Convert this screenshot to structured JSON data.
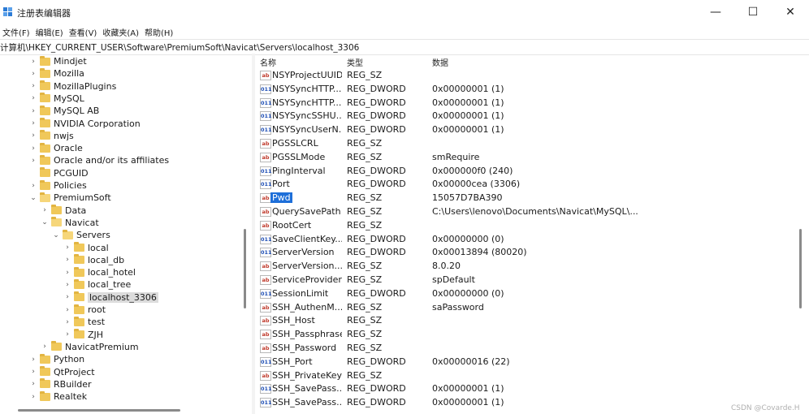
{
  "window": {
    "title": "注册表编辑器",
    "minimize": "—",
    "maximize": "☐",
    "close": "✕"
  },
  "menu": [
    "文件(F)",
    "编辑(E)",
    "查看(V)",
    "收藏夹(A)",
    "帮助(H)"
  ],
  "address": "计算机\\HKEY_CURRENT_USER\\Software\\PremiumSoft\\Navicat\\Servers\\localhost_3306",
  "tree": [
    {
      "label": "Mindjet",
      "depth": 0,
      "chev": "›",
      "open": false,
      "selected": false
    },
    {
      "label": "Mozilla",
      "depth": 0,
      "chev": "›",
      "open": false,
      "selected": false
    },
    {
      "label": "MozillaPlugins",
      "depth": 0,
      "chev": "›",
      "open": false,
      "selected": false
    },
    {
      "label": "MySQL",
      "depth": 0,
      "chev": "›",
      "open": false,
      "selected": false
    },
    {
      "label": "MySQL AB",
      "depth": 0,
      "chev": "›",
      "open": false,
      "selected": false
    },
    {
      "label": "NVIDIA Corporation",
      "depth": 0,
      "chev": "›",
      "open": false,
      "selected": false
    },
    {
      "label": "nwjs",
      "depth": 0,
      "chev": "›",
      "open": false,
      "selected": false
    },
    {
      "label": "Oracle",
      "depth": 0,
      "chev": "›",
      "open": false,
      "selected": false
    },
    {
      "label": "Oracle and/or its affiliates",
      "depth": 0,
      "chev": "›",
      "open": false,
      "selected": false
    },
    {
      "label": "PCGUID",
      "depth": 0,
      "chev": "",
      "open": false,
      "selected": false
    },
    {
      "label": "Policies",
      "depth": 0,
      "chev": "›",
      "open": false,
      "selected": false
    },
    {
      "label": "PremiumSoft",
      "depth": 0,
      "chev": "⌄",
      "open": true,
      "selected": false
    },
    {
      "label": "Data",
      "depth": 1,
      "chev": "›",
      "open": false,
      "selected": false
    },
    {
      "label": "Navicat",
      "depth": 1,
      "chev": "⌄",
      "open": true,
      "selected": false
    },
    {
      "label": "Servers",
      "depth": 2,
      "chev": "⌄",
      "open": true,
      "selected": false
    },
    {
      "label": "local",
      "depth": 3,
      "chev": "›",
      "open": false,
      "selected": false
    },
    {
      "label": "local_db",
      "depth": 3,
      "chev": "›",
      "open": false,
      "selected": false
    },
    {
      "label": "local_hotel",
      "depth": 3,
      "chev": "›",
      "open": false,
      "selected": false
    },
    {
      "label": "local_tree",
      "depth": 3,
      "chev": "›",
      "open": false,
      "selected": false
    },
    {
      "label": "localhost_3306",
      "depth": 3,
      "chev": "›",
      "open": false,
      "selected": true
    },
    {
      "label": "root",
      "depth": 3,
      "chev": "›",
      "open": false,
      "selected": false
    },
    {
      "label": "test",
      "depth": 3,
      "chev": "›",
      "open": false,
      "selected": false
    },
    {
      "label": "ZJH",
      "depth": 3,
      "chev": "›",
      "open": false,
      "selected": false
    },
    {
      "label": "NavicatPremium",
      "depth": 1,
      "chev": "›",
      "open": false,
      "selected": false
    },
    {
      "label": "Python",
      "depth": 0,
      "chev": "›",
      "open": false,
      "selected": false
    },
    {
      "label": "QtProject",
      "depth": 0,
      "chev": "›",
      "open": false,
      "selected": false
    },
    {
      "label": "RBuilder",
      "depth": 0,
      "chev": "›",
      "open": false,
      "selected": false
    },
    {
      "label": "Realtek",
      "depth": 0,
      "chev": "›",
      "open": false,
      "selected": false
    }
  ],
  "columns": {
    "name": "名称",
    "type": "类型",
    "data": "数据"
  },
  "values": [
    {
      "name": "NSYProjectUUID",
      "type": "REG_SZ",
      "data": "",
      "icon": "sz",
      "selected": false
    },
    {
      "name": "NSYSyncHTTP...",
      "type": "REG_DWORD",
      "data": "0x00000001 (1)",
      "icon": "dword",
      "selected": false
    },
    {
      "name": "NSYSyncHTTP...",
      "type": "REG_DWORD",
      "data": "0x00000001 (1)",
      "icon": "dword",
      "selected": false
    },
    {
      "name": "NSYSyncSSHU...",
      "type": "REG_DWORD",
      "data": "0x00000001 (1)",
      "icon": "dword",
      "selected": false
    },
    {
      "name": "NSYSyncUserN...",
      "type": "REG_DWORD",
      "data": "0x00000001 (1)",
      "icon": "dword",
      "selected": false
    },
    {
      "name": "PGSSLCRL",
      "type": "REG_SZ",
      "data": "",
      "icon": "sz",
      "selected": false
    },
    {
      "name": "PGSSLMode",
      "type": "REG_SZ",
      "data": "smRequire",
      "icon": "sz",
      "selected": false
    },
    {
      "name": "PingInterval",
      "type": "REG_DWORD",
      "data": "0x000000f0 (240)",
      "icon": "dword",
      "selected": false
    },
    {
      "name": "Port",
      "type": "REG_DWORD",
      "data": "0x00000cea (3306)",
      "icon": "dword",
      "selected": false
    },
    {
      "name": "Pwd",
      "type": "REG_SZ",
      "data": "15057D7BA390",
      "icon": "sz",
      "selected": true
    },
    {
      "name": "QuerySavePath",
      "type": "REG_SZ",
      "data": "C:\\Users\\lenovo\\Documents\\Navicat\\MySQL\\...",
      "icon": "sz",
      "selected": false
    },
    {
      "name": "RootCert",
      "type": "REG_SZ",
      "data": "",
      "icon": "sz",
      "selected": false
    },
    {
      "name": "SaveClientKey...",
      "type": "REG_DWORD",
      "data": "0x00000000 (0)",
      "icon": "dword",
      "selected": false
    },
    {
      "name": "ServerVersion",
      "type": "REG_DWORD",
      "data": "0x00013894 (80020)",
      "icon": "dword",
      "selected": false
    },
    {
      "name": "ServerVersion...",
      "type": "REG_SZ",
      "data": "8.0.20",
      "icon": "sz",
      "selected": false
    },
    {
      "name": "ServiceProvider",
      "type": "REG_SZ",
      "data": "spDefault",
      "icon": "sz",
      "selected": false
    },
    {
      "name": "SessionLimit",
      "type": "REG_DWORD",
      "data": "0x00000000 (0)",
      "icon": "dword",
      "selected": false
    },
    {
      "name": "SSH_AuthenM...",
      "type": "REG_SZ",
      "data": "saPassword",
      "icon": "sz",
      "selected": false
    },
    {
      "name": "SSH_Host",
      "type": "REG_SZ",
      "data": "",
      "icon": "sz",
      "selected": false
    },
    {
      "name": "SSH_Passphrase",
      "type": "REG_SZ",
      "data": "",
      "icon": "sz",
      "selected": false
    },
    {
      "name": "SSH_Password",
      "type": "REG_SZ",
      "data": "",
      "icon": "sz",
      "selected": false
    },
    {
      "name": "SSH_Port",
      "type": "REG_DWORD",
      "data": "0x00000016 (22)",
      "icon": "dword",
      "selected": false
    },
    {
      "name": "SSH_PrivateKey",
      "type": "REG_SZ",
      "data": "",
      "icon": "sz",
      "selected": false
    },
    {
      "name": "SSH_SavePass...",
      "type": "REG_DWORD",
      "data": "0x00000001 (1)",
      "icon": "dword",
      "selected": false
    },
    {
      "name": "SSH_SavePass...",
      "type": "REG_DWORD",
      "data": "0x00000001 (1)",
      "icon": "dword",
      "selected": false
    }
  ],
  "icon_text": {
    "sz": "ab",
    "dword": "011"
  },
  "watermark": "CSDN @Covarde.H",
  "colors": {
    "selection": "#1e6fd9",
    "folder": "#f0c85a"
  }
}
